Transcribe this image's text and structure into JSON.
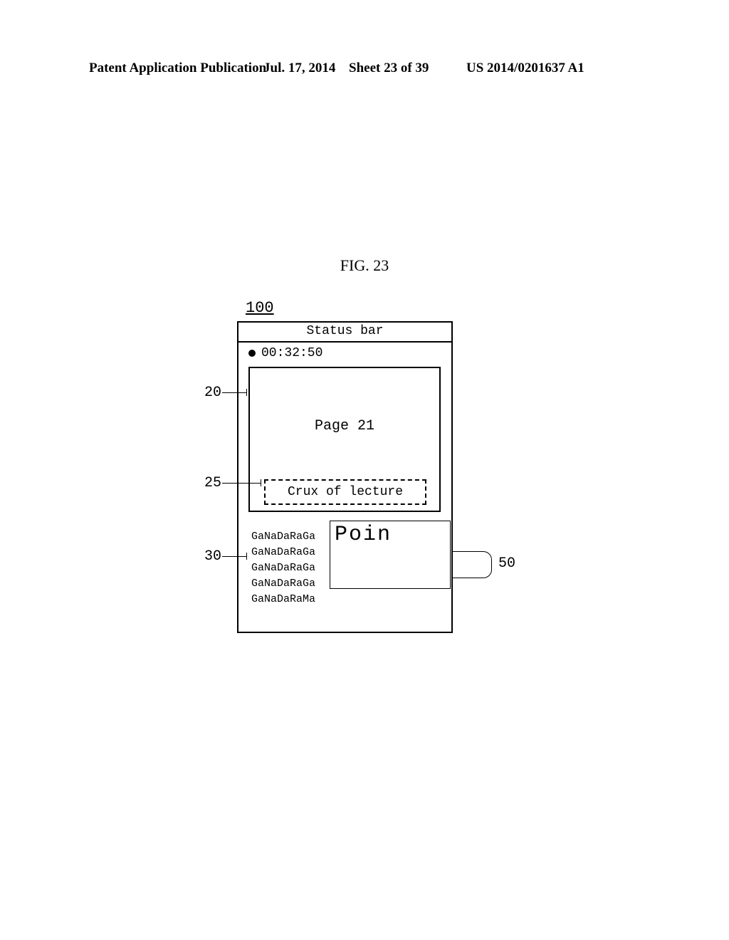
{
  "header": {
    "left": "Patent Application Publication",
    "date": "Jul. 17, 2014",
    "sheet": "Sheet 23 of 39",
    "pubno": "US 2014/0201637 A1"
  },
  "figure": {
    "label": "FIG. 23",
    "device_ref": "100"
  },
  "device": {
    "status_bar": "Status bar",
    "timer": "00:32:50",
    "page_label": "Page 21",
    "crux": "Crux of lecture",
    "notes": [
      "GaNaDaRaGa",
      "GaNaDaRaGa",
      "GaNaDaRaGa",
      "GaNaDaRaGa",
      "GaNaDaRaMa"
    ],
    "popup": "Poin"
  },
  "refs": {
    "r20": "20",
    "r25": "25",
    "r30": "30",
    "r50": "50"
  }
}
